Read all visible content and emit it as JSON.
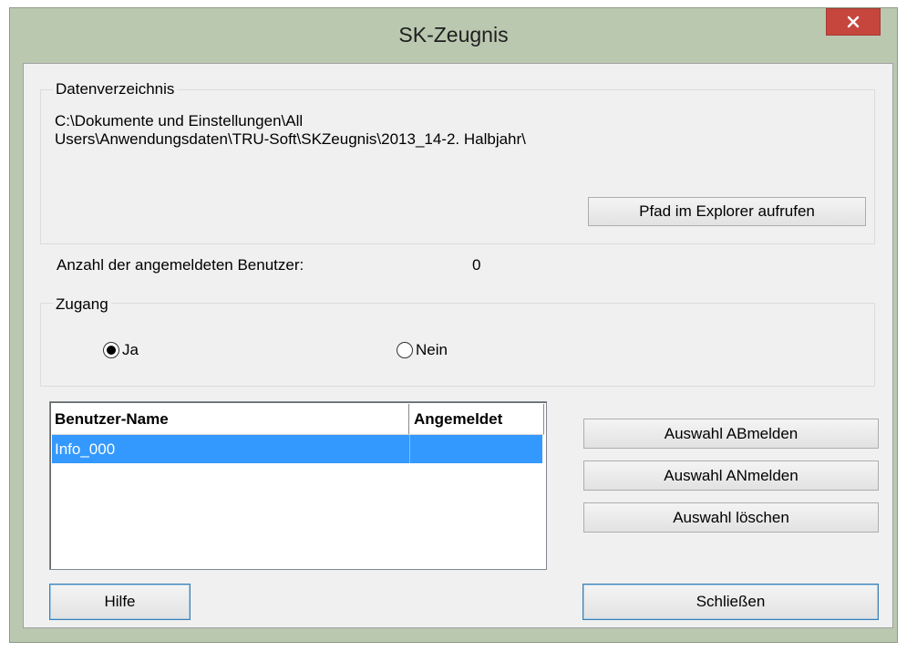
{
  "window": {
    "title": "SK-Zeugnis"
  },
  "datenverzeichnis": {
    "label": "Datenverzeichnis",
    "path_line1": "C:\\Dokumente und Einstellungen\\All",
    "path_line2": "Users\\Anwendungsdaten\\TRU-Soft\\SKZeugnis\\2013_14-2. Halbjahr\\",
    "explorer_button": "Pfad im Explorer aufrufen"
  },
  "users_count": {
    "label": "Anzahl der angemeldeten Benutzer:",
    "value": "0"
  },
  "zugang": {
    "label": "Zugang",
    "options": [
      {
        "label": "Ja",
        "selected": true
      },
      {
        "label": "Nein",
        "selected": false
      }
    ]
  },
  "user_list": {
    "columns": [
      "Benutzer-Name",
      "Angemeldet"
    ],
    "rows": [
      {
        "name": "Info_000",
        "angemeldet": "",
        "selected": true
      }
    ]
  },
  "actions": {
    "abmelden": "Auswahl ABmelden",
    "anmelden": "Auswahl ANmelden",
    "loeschen": "Auswahl löschen"
  },
  "footer": {
    "help": "Hilfe",
    "close": "Schließen"
  },
  "icons": {
    "close": "close-icon"
  },
  "colors": {
    "frame": "#bac8b0",
    "close_button": "#c6463d",
    "selection": "#3399ff",
    "client": "#f0f0f0"
  }
}
